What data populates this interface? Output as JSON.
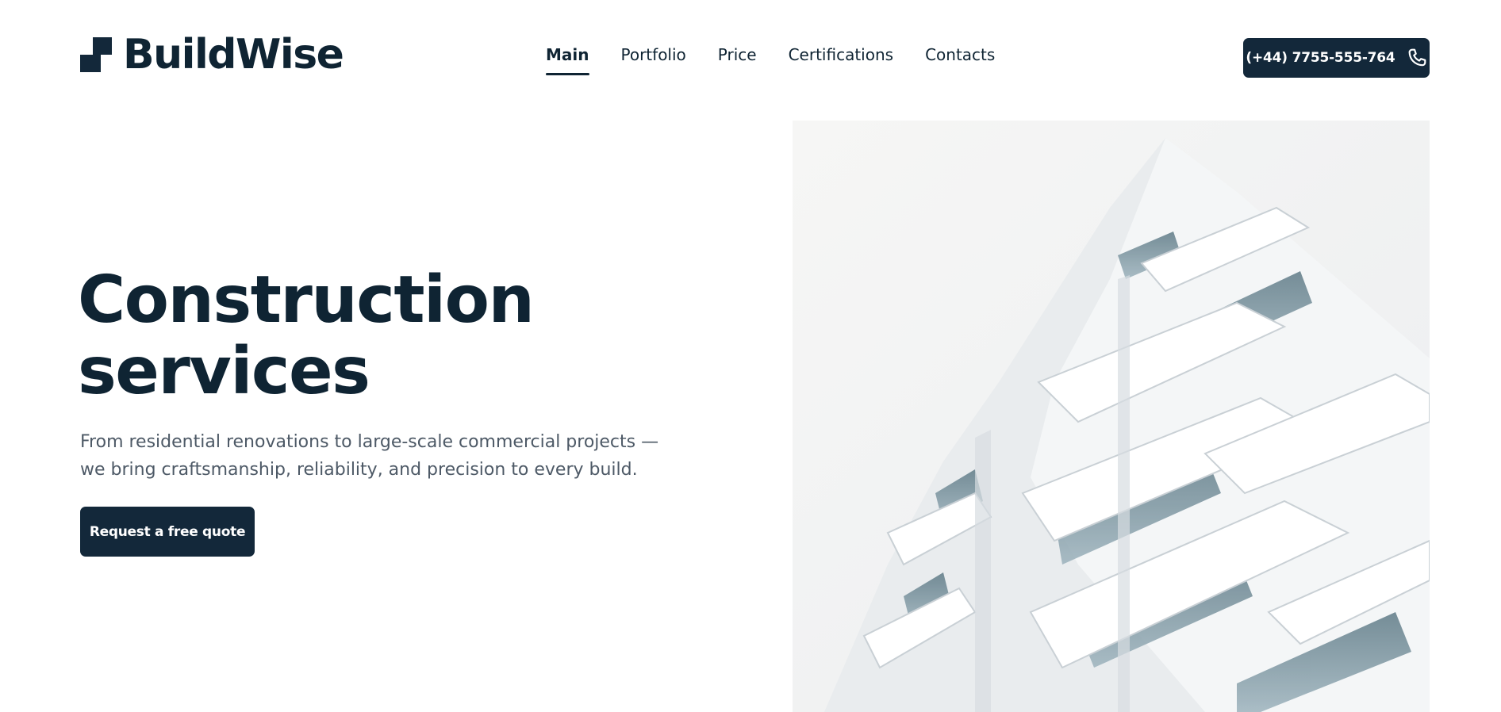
{
  "brand": {
    "name": "BuildWise",
    "logo_icon": "stepped-square-logo-icon",
    "primary_color": "#13283a",
    "text_color": "#0f2433",
    "muted_text_color": "#4d5966"
  },
  "nav": {
    "items": [
      {
        "label": "Main",
        "active": true
      },
      {
        "label": "Portfolio",
        "active": false
      },
      {
        "label": "Price",
        "active": false
      },
      {
        "label": "Certifications",
        "active": false
      },
      {
        "label": "Contacts",
        "active": false
      }
    ]
  },
  "contact": {
    "phone": "(+44) 7755-555-764",
    "icon": "phone-icon"
  },
  "hero": {
    "title_line1": "Construction",
    "title_line2": "services",
    "subtitle_line1": "From residential renovations to large-scale commercial projects —",
    "subtitle_line2": "we bring craftsmanship, reliability, and precision to every build.",
    "cta_label": "Request a free quote",
    "image": "white-modern-apartment-building-photo"
  }
}
